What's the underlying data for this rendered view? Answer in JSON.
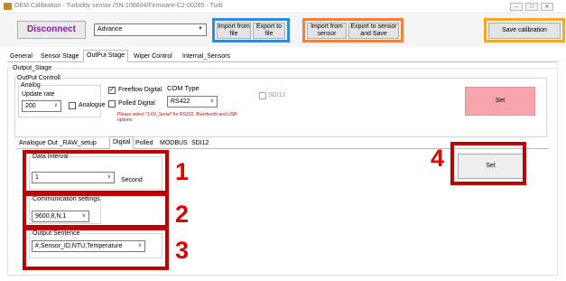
{
  "window": {
    "title": "OEM Calibration - Turbidity sensor /SN-108604/Firmware-C2-00285 - Turb",
    "min": "–",
    "max": "□",
    "close": "✕"
  },
  "toolbar": {
    "disconnect": "Disconnect",
    "mode_value": "Advance",
    "import_file": "Import from file",
    "export_file": "Export to file",
    "import_sensor": "Import from sensor",
    "export_sensor": "Export to sensor and Save",
    "save_calibration": "Save calibration"
  },
  "tabs": [
    "General",
    "Sensor Stage",
    "OutPut Stage",
    "Wiper Control",
    "Internal_Sensors"
  ],
  "output_stage": {
    "title": "Output_Stage",
    "control_title": "OutPut Controll",
    "analog_title": "Analog",
    "update_rate_label": "Update rate",
    "update_rate_value": "200",
    "analogue_label": "Analogue",
    "freeflow_label": "Freeflow Digital",
    "freeflow_check": "✓",
    "polled_label": "Polled Digital",
    "com_type_label": "COM Type",
    "com_type_value": "RS422",
    "note": "Please select \"3.6V_Serial\" for RS232, Bluethooth and USB options.",
    "sdi12_label": "SDI12",
    "set": "Set"
  },
  "subtabs": [
    "Analogue Out _RAW_setup",
    "Digital",
    "Polled",
    "MODBUS",
    "SDI12"
  ],
  "digital": {
    "data_interval_label": "Data Interval",
    "data_interval_value": "1",
    "second_label": "Second",
    "comm_label": "Communication settings",
    "comm_value": "9600,8,N,1",
    "sentence_label": "Output Sentence",
    "sentence_value": "#,Sensor_ID,NTU,Temperature",
    "set": "Set"
  },
  "annotations": [
    "1",
    "2",
    "3",
    "4"
  ],
  "colors": {
    "blue_frame": "#2e8bde",
    "orange_frame": "#f0823c",
    "gold_frame": "#f5a623",
    "red": "#c00000",
    "disconnect_text": "#7a1fa0"
  }
}
